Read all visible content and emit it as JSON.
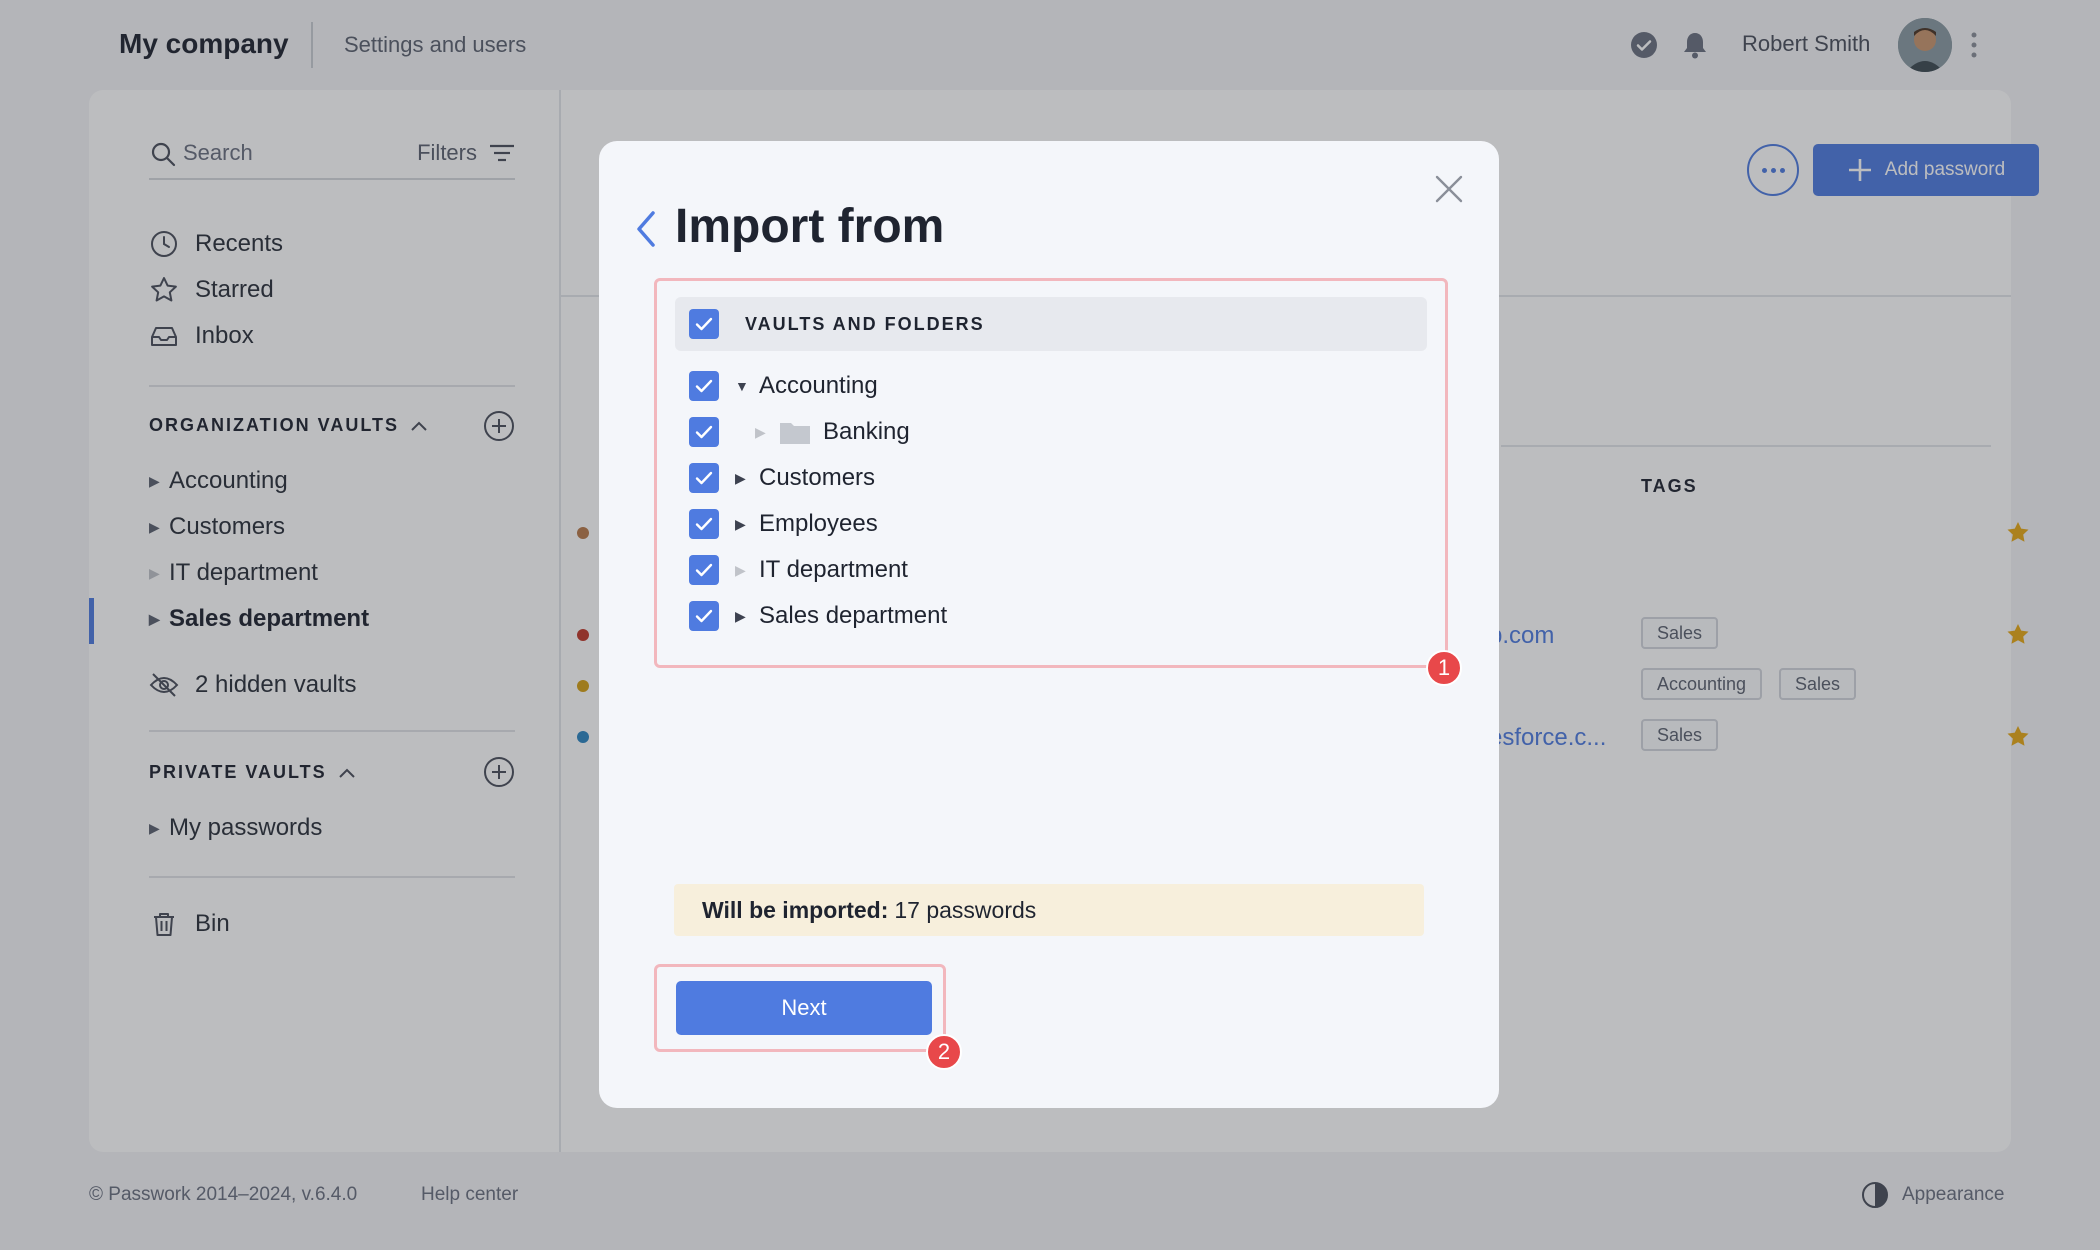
{
  "header": {
    "company": "My company",
    "settings_link": "Settings and users",
    "user_name": "Robert Smith"
  },
  "sidebar": {
    "search_placeholder": "Search",
    "filters_label": "Filters",
    "nav": [
      {
        "label": "Recents",
        "icon": "clock-icon"
      },
      {
        "label": "Starred",
        "icon": "star-icon"
      },
      {
        "label": "Inbox",
        "icon": "inbox-icon"
      }
    ],
    "org_vaults_title": "ORGANIZATION VAULTS",
    "org_vaults": [
      "Accounting",
      "Customers",
      "IT department",
      "Sales department"
    ],
    "active_vault": "Sales department",
    "hidden_vaults": "2 hidden vaults",
    "private_vaults_title": "PRIVATE VAULTS",
    "private_vaults": [
      "My passwords"
    ],
    "bin_label": "Bin"
  },
  "content": {
    "add_password_label": "Add password",
    "tags_header": "TAGS",
    "rows": [
      {
        "link": "",
        "tags": [],
        "starred": true,
        "dot_color": "#b87a4b"
      },
      {
        "link": "p.com",
        "tags": [
          "Sales"
        ],
        "starred": true,
        "dot_color": "#c0392b"
      },
      {
        "link": "",
        "tags": [
          "Accounting",
          "Sales"
        ],
        "starred": false,
        "dot_color": "#d4a017"
      },
      {
        "link": "esforce.c...",
        "tags": [
          "Sales"
        ],
        "starred": true,
        "dot_color": "#2e86c1"
      }
    ]
  },
  "footer": {
    "copyright": "© Passwork 2014–2024, v.6.4.0",
    "help": "Help center",
    "appearance": "Appearance"
  },
  "modal": {
    "title": "Import from",
    "header_label": "VAULTS AND FOLDERS",
    "tree": [
      {
        "label": "Accounting",
        "expanded": true,
        "checked": true
      },
      {
        "label": "Banking",
        "folder": true,
        "checked": true
      },
      {
        "label": "Customers",
        "checked": true
      },
      {
        "label": "Employees",
        "checked": true
      },
      {
        "label": "IT department",
        "checked": true
      },
      {
        "label": "Sales department",
        "checked": true
      }
    ],
    "import_note_label": "Will be imported:",
    "import_note_value": "17 passwords",
    "next_label": "Next",
    "badges": [
      "1",
      "2"
    ]
  },
  "colors": {
    "accent": "#4f7be0",
    "badge": "#e8484a",
    "highlight_border": "#f2b7bd",
    "star": "#e6a817"
  }
}
